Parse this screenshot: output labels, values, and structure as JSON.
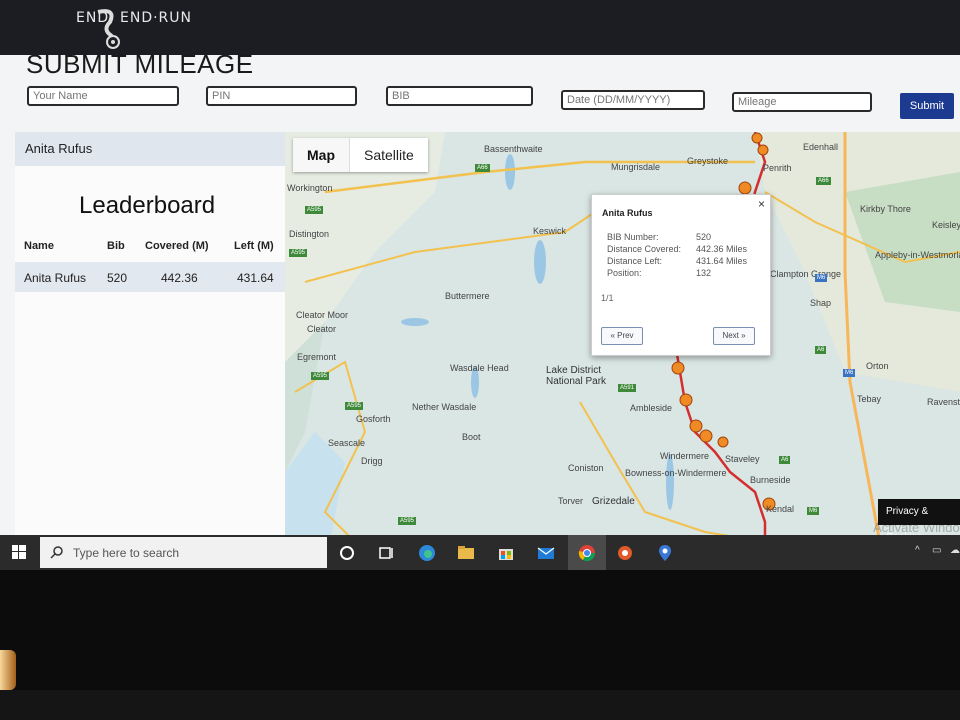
{
  "brand": {
    "part1": "END",
    "part2": "END·RUN"
  },
  "form": {
    "title": "SUBMIT MILEAGE",
    "name_placeholder": "Your Name",
    "pin_placeholder": "PIN",
    "bib_placeholder": "BIB",
    "date_placeholder": "Date (DD/MM/YYYY)",
    "mileage_placeholder": "Mileage",
    "submit_label": "Submit"
  },
  "current_user": "Anita Rufus",
  "leaderboard": {
    "title": "Leaderboard",
    "columns": [
      "Name",
      "Bib",
      "Covered (M)",
      "Left (M)"
    ],
    "rows": [
      {
        "name": "Anita Rufus",
        "bib": "520",
        "covered": "442.36",
        "left": "431.64"
      }
    ]
  },
  "map": {
    "tabs": [
      "Map",
      "Satellite"
    ],
    "active_tab": "Map",
    "places": [
      "Bassenthwaite",
      "Mungrisdale",
      "Greystoke",
      "Penrith",
      "Edenhall",
      "Workington",
      "Distington",
      "Keswick",
      "Kirkby Thore",
      "Keisley",
      "Appleby-in-Westmorland",
      "Clampton Grange",
      "Shap",
      "Buttermere",
      "Cleator Moor",
      "Cleator",
      "Egremont",
      "Wasdale Head",
      "Lake District National Park",
      "Ambleside",
      "Orton",
      "Tebay",
      "Ravenstonedale",
      "Nether Wasdale",
      "Gosforth",
      "Boot",
      "Seascale",
      "Drigg",
      "Windermere",
      "Staveley",
      "Coniston",
      "Bowness-on-Windermere",
      "Burneside",
      "Torver",
      "Grizedale",
      "Kendal"
    ],
    "roads": [
      "A66",
      "A595",
      "A595",
      "A66",
      "A66",
      "A591",
      "A595",
      "A595",
      "A595",
      "M6",
      "M6",
      "A6",
      "A6",
      "A591",
      "A6",
      "M6",
      "M6",
      "A595"
    ],
    "route_color": "#d32f2f",
    "popup": {
      "name": "Anita Rufus",
      "bib_label": "BIB Number:",
      "bib_value": "520",
      "covered_label": "Distance Covered:",
      "covered_value": "442.36 Miles",
      "left_label": "Distance Left:",
      "left_value": "431.64 Miles",
      "position_label": "Position:",
      "position_value": "132",
      "pager": "1/1",
      "prev_label": "« Prev",
      "next_label": "Next »"
    },
    "cookie_label": "Privacy & Cookies",
    "watermark": "Activate Windows"
  },
  "taskbar": {
    "search_placeholder": "Type here to search",
    "icons": [
      "windows-icon",
      "cortana-icon",
      "task-view-icon",
      "edge-icon",
      "file-explorer-icon",
      "store-icon",
      "mail-icon",
      "chrome-icon",
      "app-icon",
      "maps-app-icon"
    ]
  }
}
